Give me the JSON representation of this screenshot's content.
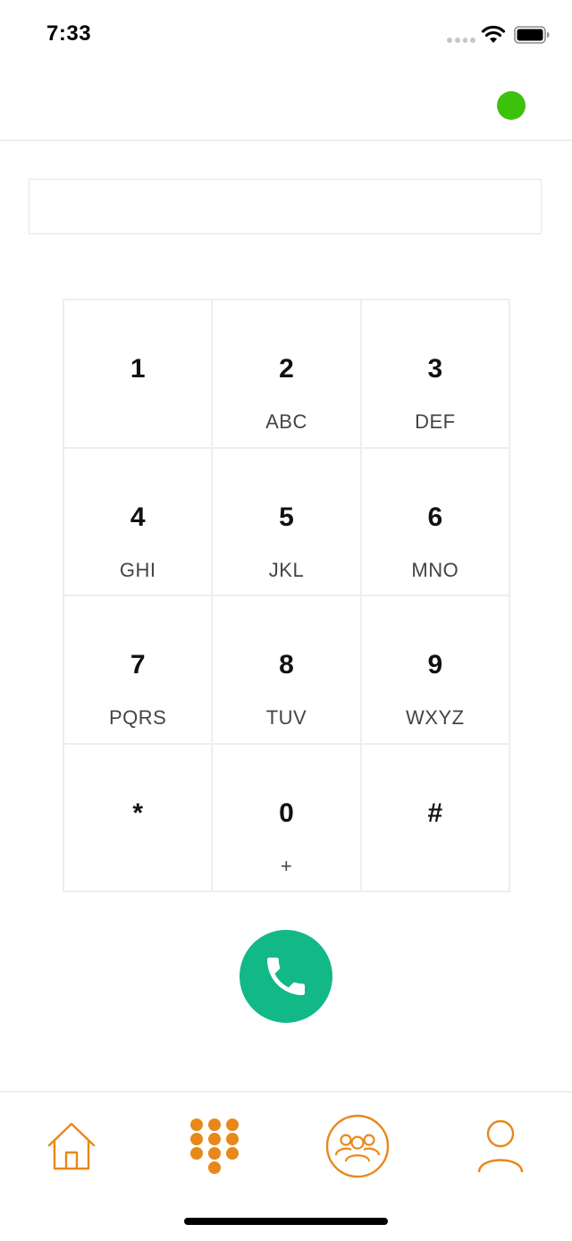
{
  "status_bar": {
    "time": "7:33",
    "icons": [
      "signal-dots-icon",
      "wifi-icon",
      "battery-icon"
    ]
  },
  "header": {
    "presence_status_color": "#3cc20a"
  },
  "dial_input": {
    "value": "",
    "placeholder": ""
  },
  "keypad": {
    "keys": [
      {
        "digit": "1",
        "letters": ""
      },
      {
        "digit": "2",
        "letters": "ABC"
      },
      {
        "digit": "3",
        "letters": "DEF"
      },
      {
        "digit": "4",
        "letters": "GHI"
      },
      {
        "digit": "5",
        "letters": "JKL"
      },
      {
        "digit": "6",
        "letters": "MNO"
      },
      {
        "digit": "7",
        "letters": "PQRS"
      },
      {
        "digit": "8",
        "letters": "TUV"
      },
      {
        "digit": "9",
        "letters": "WXYZ"
      },
      {
        "digit": "*",
        "letters": ""
      },
      {
        "digit": "0",
        "letters": "+"
      },
      {
        "digit": "#",
        "letters": ""
      }
    ]
  },
  "call_button": {
    "icon": "phone-icon",
    "color": "#12b886"
  },
  "bottom_nav": {
    "accent_color": "#e8881a",
    "items": [
      {
        "icon": "home-icon",
        "active": false
      },
      {
        "icon": "keypad-icon",
        "active": true
      },
      {
        "icon": "contacts-group-icon",
        "active": false
      },
      {
        "icon": "profile-icon",
        "active": false
      }
    ]
  }
}
